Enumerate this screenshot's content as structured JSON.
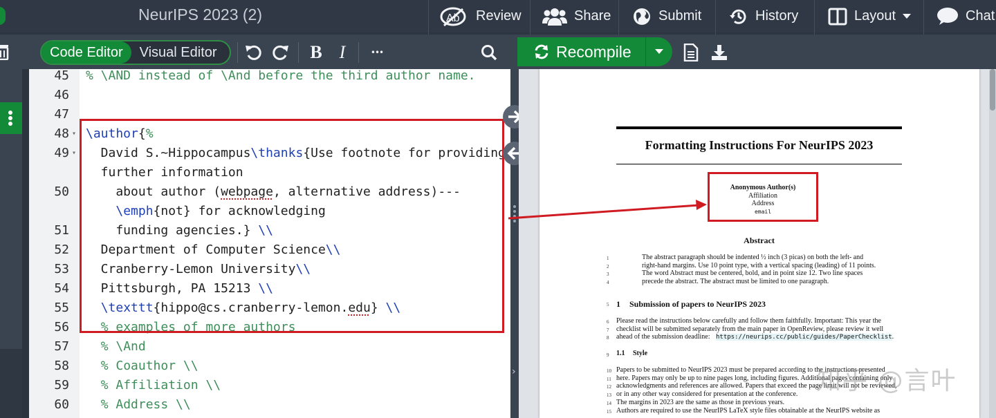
{
  "topbar": {
    "title": "NeurIPS 2023 (2)",
    "review_label": "Review",
    "share_label": "Share",
    "submit_label": "Submit",
    "history_label": "History",
    "layout_label": "Layout",
    "chat_label": "Chat"
  },
  "toolbar": {
    "code_editor_label": "Code Editor",
    "visual_editor_label": "Visual Editor",
    "bold_label": "B",
    "italic_label": "I",
    "more_label": "•••",
    "recompile_label": "Recompile"
  },
  "editor": {
    "lines": [
      {
        "n": "45",
        "text": "% \\AND instead of \\And before the third author name."
      },
      {
        "n": "46",
        "text": ""
      },
      {
        "n": "47",
        "text": ""
      },
      {
        "n": "48",
        "text": "\\author{%"
      },
      {
        "n": "49",
        "text": "  David S.~Hippocampus\\thanks{Use footnote for providing"
      },
      {
        "n": "",
        "text": "  further information"
      },
      {
        "n": "50",
        "text": "    about author (webpage, alternative address)---"
      },
      {
        "n": "",
        "text": "    \\emph{not} for acknowledging"
      },
      {
        "n": "51",
        "text": "    funding agencies.} \\\\"
      },
      {
        "n": "52",
        "text": "  Department of Computer Science\\\\"
      },
      {
        "n": "53",
        "text": "  Cranberry-Lemon University\\\\"
      },
      {
        "n": "54",
        "text": "  Pittsburgh, PA 15213 \\\\"
      },
      {
        "n": "55",
        "text": "  \\texttt{hippo@cs.cranberry-lemon.edu} \\\\"
      },
      {
        "n": "56",
        "text": "  % examples of more authors"
      },
      {
        "n": "57",
        "text": "  % \\And"
      },
      {
        "n": "58",
        "text": "  % Coauthor \\\\"
      },
      {
        "n": "59",
        "text": "  % Affiliation \\\\"
      },
      {
        "n": "60",
        "text": "  % Address \\\\"
      }
    ]
  },
  "pdf": {
    "title": "Formatting Instructions For NeurIPS 2023",
    "author_name": "Anonymous Author(s)",
    "affiliation": "Affiliation",
    "address": "Address",
    "email": "email",
    "abstract_heading": "Abstract",
    "abstract_lines": [
      {
        "n": "1",
        "text": "The abstract paragraph should be indented ½ inch (3 picas) on both the left- and"
      },
      {
        "n": "2",
        "text": "right-hand margins. Use 10 point type, with a vertical spacing (leading) of 11 points."
      },
      {
        "n": "3",
        "text": "The word Abstract must be centered, bold, and in point size 12. Two line spaces"
      },
      {
        "n": "4",
        "text": "precede the abstract. The abstract must be limited to one paragraph."
      }
    ],
    "section1_num": "1",
    "section1_title": "Submission of papers to NeurIPS 2023",
    "section1_line_num": "5",
    "section1_lines": [
      {
        "n": "6",
        "text": "Please read the instructions below carefully and follow them faithfully. Important: This year the"
      },
      {
        "n": "7",
        "text": "checklist will be submitted separately from the main paper in OpenReview, please review it well"
      },
      {
        "n": "8",
        "text": "ahead of the submission deadline:"
      }
    ],
    "checklist_link": "https://neurips.cc/public/guides/PaperChecklist",
    "subsection_num": "1.1",
    "subsection_title": "Style",
    "subsection_line_num": "9",
    "style_lines": [
      {
        "n": "10",
        "text": "Papers to be submitted to NeurIPS 2023 must be prepared according to the instructions presented"
      },
      {
        "n": "11",
        "text": "here. Papers may only be up to nine pages long, including figures. Additional pages containing only"
      },
      {
        "n": "12",
        "text": "acknowledgments and references are allowed. Papers that exceed the page limit will not be reviewed,"
      },
      {
        "n": "13",
        "text": "or in any other way considered for presentation at the conference."
      },
      {
        "n": "14",
        "text": "The margins in 2023 are the same as those in previous years."
      },
      {
        "n": "15",
        "text": "Authors are required to use the NeurIPS LaTeX style files obtainable at the NeurIPS website as"
      }
    ]
  },
  "watermark": "知乎 @言叶",
  "colors": {
    "accent_green": "#138a37",
    "highlight_red": "#d01b22",
    "topbar_bg": "#2f3844",
    "toolbar_bg": "#3a4350"
  }
}
